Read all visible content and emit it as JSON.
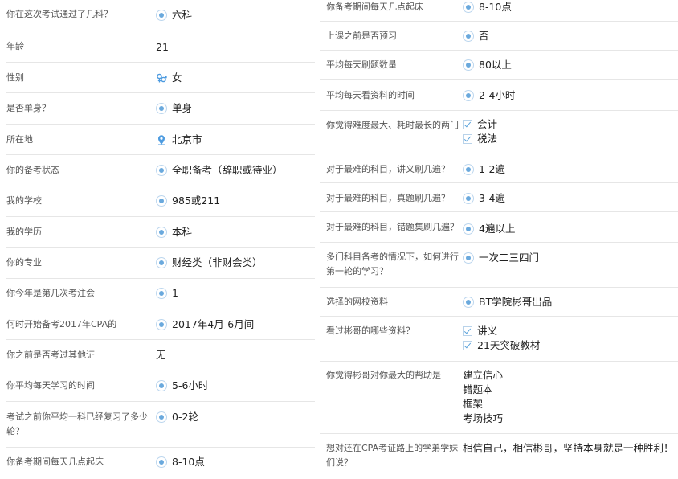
{
  "left": [
    {
      "q": "你在这次考试通过了几科？",
      "icon": "radio-icon",
      "a": [
        "六科"
      ]
    },
    {
      "q": "年龄",
      "icon": "none",
      "a": [
        "21"
      ]
    },
    {
      "q": "性别",
      "icon": "gender-icon",
      "a": [
        "女"
      ]
    },
    {
      "q": "是否单身？",
      "icon": "radio-icon",
      "a": [
        "单身"
      ]
    },
    {
      "q": "所在地",
      "icon": "location-pin-icon",
      "a": [
        "北京市"
      ]
    },
    {
      "q": "你的备考状态",
      "icon": "radio-icon",
      "a": [
        "全职备考（辞职或待业）"
      ]
    },
    {
      "q": "我的学校",
      "icon": "radio-icon",
      "a": [
        "985或211"
      ]
    },
    {
      "q": "我的学历",
      "icon": "radio-icon",
      "a": [
        "本科"
      ]
    },
    {
      "q": "你的专业",
      "icon": "radio-icon",
      "a": [
        "财经类（非财会类）"
      ]
    },
    {
      "q": "你今年是第几次考注会",
      "icon": "radio-icon",
      "a": [
        "1"
      ]
    },
    {
      "q": "何时开始备考2017年CPA的",
      "icon": "radio-icon",
      "a": [
        "2017年4月-6月间"
      ]
    },
    {
      "q": "你之前是否考过其他证",
      "icon": "none",
      "a": [
        "无"
      ]
    },
    {
      "q": "你平均每天学习的时间",
      "icon": "radio-icon",
      "a": [
        "5-6小时"
      ]
    },
    {
      "q": "考试之前你平均一科已经复习了多少轮？",
      "icon": "radio-icon",
      "a": [
        "0-2轮"
      ]
    },
    {
      "q": "你备考期间每天几点起床",
      "icon": "radio-icon",
      "a": [
        "8-10点"
      ]
    }
  ],
  "right": [
    {
      "q": "你备考期间每天几点起床",
      "icon": "radio-icon",
      "a": [
        "8-10点"
      ]
    },
    {
      "q": "上课之前是否预习",
      "icon": "radio-icon",
      "a": [
        "否"
      ]
    },
    {
      "q": "平均每天刷题数量",
      "icon": "radio-icon",
      "a": [
        "80以上"
      ]
    },
    {
      "q": "平均每天看资料的时间",
      "icon": "radio-icon",
      "a": [
        "2-4小时"
      ]
    },
    {
      "q": "你觉得难度最大、耗时最长的两门",
      "icon": "checkbox-icon",
      "a": [
        "会计",
        "税法"
      ]
    },
    {
      "q": "对于最难的科目，讲义刷几遍？",
      "icon": "radio-icon",
      "a": [
        "1-2遍"
      ]
    },
    {
      "q": "对于最难的科目，真题刷几遍？",
      "icon": "radio-icon",
      "a": [
        "3-4遍"
      ]
    },
    {
      "q": "对于最难的科目，错题集刷几遍？",
      "icon": "radio-icon",
      "a": [
        "4遍以上"
      ]
    },
    {
      "q": "多门科目备考的情况下，如何进行第一轮的学习？",
      "icon": "radio-icon",
      "a": [
        "一次二三四门"
      ]
    },
    {
      "q": "选择的网校资料",
      "icon": "radio-icon",
      "a": [
        "BT学院彬哥出品"
      ]
    },
    {
      "q": "看过彬哥的哪些资料？",
      "icon": "checkbox-icon",
      "a": [
        "讲义",
        "21天突破教材"
      ]
    },
    {
      "q": "你觉得彬哥对你最大的帮助是",
      "icon": "none",
      "a": [
        "建立信心",
        "错题本",
        "框架",
        "考场技巧"
      ]
    },
    {
      "q": "想对还在CPA考证路上的学弟学妹们说？",
      "icon": "none",
      "a": [
        "相信自己，相信彬哥，坚持本身就是一种胜利！"
      ]
    }
  ],
  "colors": {
    "accent": "#6aa9dd",
    "divider": "#e6e6e6",
    "question": "#555555",
    "answer": "#222222"
  }
}
